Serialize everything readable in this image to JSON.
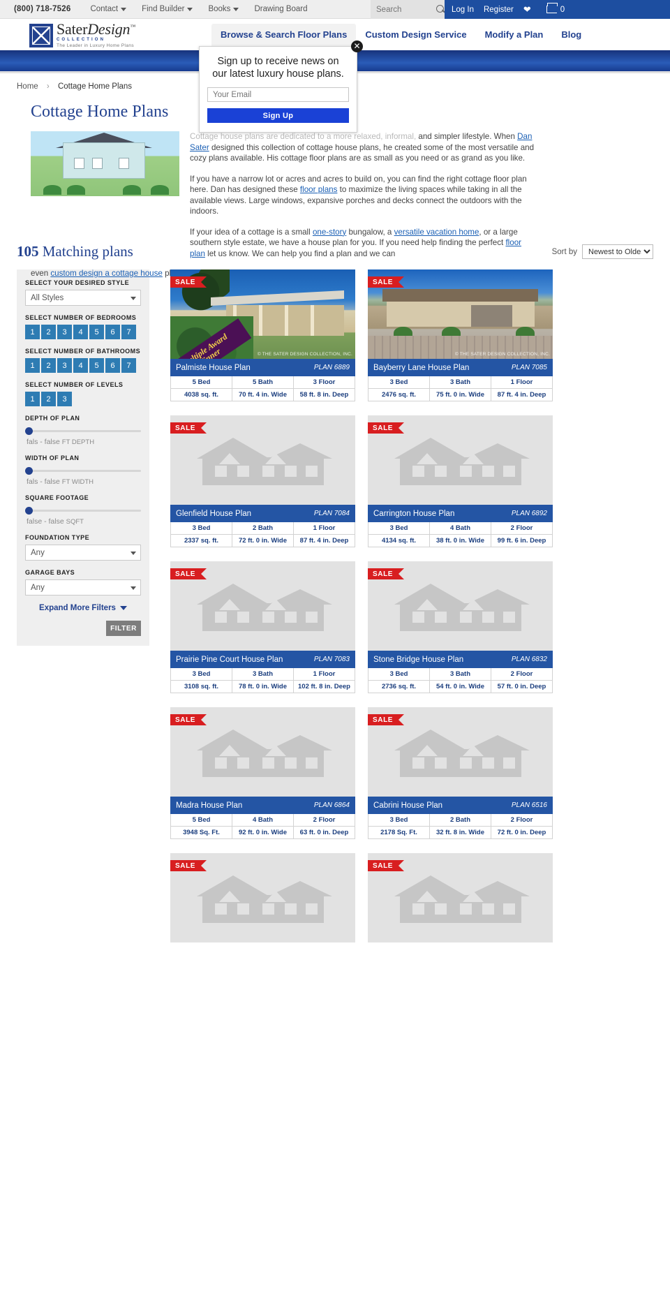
{
  "utility": {
    "phone": "(800) 718-7526",
    "links": [
      {
        "label": "Contact",
        "caret": true
      },
      {
        "label": "Find Builder",
        "caret": true
      },
      {
        "label": "Books",
        "caret": true
      },
      {
        "label": "Drawing Board",
        "caret": false
      }
    ],
    "search_placeholder": "Search",
    "search_value": "",
    "search_icon": "search-icon",
    "login": "Log In",
    "register": "Register",
    "wishlist_icon": "heart-icon",
    "cart_icon": "cart-icon",
    "cart_count": "0"
  },
  "brand": {
    "name_part1": "Sater",
    "name_part2": "Design",
    "trademark": "™",
    "collection": "COLLECTION",
    "tagline": "The Leader in Luxury Home Plans"
  },
  "mainnav": [
    {
      "label": "Browse & Search Floor Plans",
      "active": true
    },
    {
      "label": "Custom Design Service",
      "active": false
    },
    {
      "label": "Modify a Plan",
      "active": false
    },
    {
      "label": "Blog",
      "active": false
    }
  ],
  "breadcrumb": {
    "home": "Home",
    "separator": "›",
    "current": "Cottage Home Plans"
  },
  "page_title": "Cottage Home Plans",
  "intro": {
    "p1_obscured": "Cottage house plans are dedicated to a more relaxed, informal,",
    "p1_rest": " and simpler lifestyle. When ",
    "p1_link": "Dan Sater",
    "p1_tail": " designed this collection of cottage house plans, he created some of the most versatile and cozy plans available. His cottage floor plans are as small as you need or as grand as you like.",
    "p2_a": "If you have a narrow lot or acres and acres to build on, you can find the right cottage floor plan here. Dan has designed these ",
    "p2_link": "floor plans",
    "p2_b": " to maximize the living spaces while taking in all the available views. Large windows, expansive porches and decks connect the outdoors with the indoors.",
    "p3_a": "If your idea of a cottage is a small ",
    "p3_link1": "one-story",
    "p3_b": " bungalow, a ",
    "p3_link2": "versatile vacation home",
    "p3_c": ", or a large southern style estate, we have a house plan for you. If you need help finding the perfect ",
    "p3_link3": "floor plan",
    "p3_d": " let us know. We can help you find a plan and we can ",
    "p4_a": "even ",
    "p4_link": "custom design a cottage house",
    "p4_b": " plan just for you."
  },
  "results": {
    "count": "105",
    "count_suffix": "Matching plans",
    "sort_label": "Sort by",
    "sort_value": "Newest to Oldest",
    "sort_options": [
      "Newest to Oldest"
    ]
  },
  "filters": {
    "style_label": "SELECT YOUR DESIRED STYLE",
    "style_value": "All Styles",
    "bedrooms_label": "SELECT NUMBER OF BEDROOMS",
    "bedrooms": [
      "1",
      "2",
      "3",
      "4",
      "5",
      "6",
      "7"
    ],
    "bathrooms_label": "SELECT NUMBER OF BATHROOMS",
    "bathrooms": [
      "1",
      "2",
      "3",
      "4",
      "5",
      "6",
      "7"
    ],
    "levels_label": "SELECT NUMBER OF LEVELS",
    "levels": [
      "1",
      "2",
      "3"
    ],
    "depth_label": "DEPTH OF PLAN",
    "depth_range": "fals  -  false",
    "depth_unit": "FT DEPTH",
    "width_label": "WIDTH OF PLAN",
    "width_range": "fals  -  false",
    "width_unit": "FT WIDTH",
    "sqft_label": "SQUARE FOOTAGE",
    "sqft_range": "false  -  false",
    "sqft_unit": "SQFT",
    "foundation_label": "FOUNDATION TYPE",
    "foundation_value": "Any",
    "garage_label": "GARAGE BAYS",
    "garage_value": "Any",
    "expand_label": "Expand More Filters",
    "filter_button": "FILTER",
    "accent_color": "#2e7cb3",
    "knob_color": "#23428f"
  },
  "modal": {
    "heading_line1": "Sign up to receive news on",
    "heading_line2": "our latest luxury house plans.",
    "email_placeholder": "Your Email",
    "email_value": "",
    "submit": "Sign Up",
    "close_icon": "close-icon",
    "close_glyph": "✕"
  },
  "copyright_notice": "© THE SATER DESIGN COLLECTION, INC.",
  "sale_badge": "SALE",
  "award_badge_line1": "Multiple Award",
  "award_badge_line2": "Winner",
  "plans": [
    {
      "name": "Palmiste House Plan",
      "plan": "PLAN 6889",
      "bed": "5 Bed",
      "bath": "5 Bath",
      "floor": "3 Floor",
      "sqft": "4038 sq. ft.",
      "width": "70 ft. 4 in. Wide",
      "depth": "58 ft. 8 in. Deep",
      "sale": true,
      "award": true,
      "image": "photo-a"
    },
    {
      "name": "Bayberry Lane House Plan",
      "plan": "PLAN 7085",
      "bed": "3 Bed",
      "bath": "3 Bath",
      "floor": "1 Floor",
      "sqft": "2476 sq. ft.",
      "width": "75 ft. 0 in. Wide",
      "depth": "87 ft. 4 in. Deep",
      "sale": true,
      "award": false,
      "image": "photo-b"
    },
    {
      "name": "Glenfield House Plan",
      "plan": "PLAN 7084",
      "bed": "3 Bed",
      "bath": "2 Bath",
      "floor": "1 Floor",
      "sqft": "2337 sq. ft.",
      "width": "72 ft. 0 in. Wide",
      "depth": "87 ft. 4 in. Deep",
      "sale": true,
      "award": false,
      "image": "placeholder"
    },
    {
      "name": "Carrington House Plan",
      "plan": "PLAN 6892",
      "bed": "3 Bed",
      "bath": "4 Bath",
      "floor": "2 Floor",
      "sqft": "4134 sq. ft.",
      "width": "38 ft. 0 in. Wide",
      "depth": "99 ft. 6 in. Deep",
      "sale": true,
      "award": false,
      "image": "placeholder"
    },
    {
      "name": "Prairie Pine Court House Plan",
      "plan": "PLAN 7083",
      "bed": "3 Bed",
      "bath": "3 Bath",
      "floor": "1 Floor",
      "sqft": "3108 sq. ft.",
      "width": "78 ft. 0 in. Wide",
      "depth": "102 ft. 8 in. Deep",
      "sale": true,
      "award": false,
      "image": "placeholder"
    },
    {
      "name": "Stone Bridge House Plan",
      "plan": "PLAN 6832",
      "bed": "3 Bed",
      "bath": "3 Bath",
      "floor": "2 Floor",
      "sqft": "2736 sq. ft.",
      "width": "54 ft. 0 in. Wide",
      "depth": "57 ft. 0 in. Deep",
      "sale": true,
      "award": false,
      "image": "placeholder"
    },
    {
      "name": "Madra House Plan",
      "plan": "PLAN 6864",
      "bed": "5 Bed",
      "bath": "4 Bath",
      "floor": "2 Floor",
      "sqft": "3948 Sq. Ft.",
      "width": "92 ft. 0 in. Wide",
      "depth": "63 ft. 0 in. Deep",
      "sale": true,
      "award": false,
      "image": "placeholder"
    },
    {
      "name": "Cabrini House Plan",
      "plan": "PLAN 6516",
      "bed": "3 Bed",
      "bath": "2 Bath",
      "floor": "2 Floor",
      "sqft": "2178 Sq. Ft.",
      "width": "32 ft. 8 in. Wide",
      "depth": "72 ft. 0 in. Deep",
      "sale": true,
      "award": false,
      "image": "placeholder"
    },
    {
      "name": "",
      "plan": "",
      "bed": "",
      "bath": "",
      "floor": "",
      "sqft": "",
      "width": "",
      "depth": "",
      "sale": true,
      "award": false,
      "image": "placeholder"
    },
    {
      "name": "",
      "plan": "",
      "bed": "",
      "bath": "",
      "floor": "",
      "sqft": "",
      "width": "",
      "depth": "",
      "sale": true,
      "award": false,
      "image": "placeholder"
    }
  ]
}
